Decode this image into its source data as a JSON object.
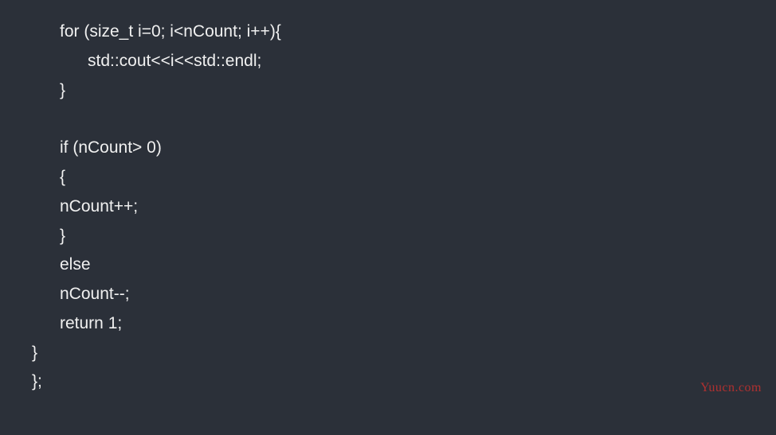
{
  "code": {
    "lines": [
      {
        "indent": 1,
        "text": "for (size_t i=0; i<nCount; i++){"
      },
      {
        "indent": 2,
        "text": "std::cout<<i<<std::endl;"
      },
      {
        "indent": 1,
        "text": "}"
      },
      {
        "indent": 1,
        "text": ""
      },
      {
        "indent": 1,
        "text": "if (nCount> 0)"
      },
      {
        "indent": 1,
        "text": "{"
      },
      {
        "indent": 1,
        "text": "nCount++;"
      },
      {
        "indent": 1,
        "text": "}"
      },
      {
        "indent": 1,
        "text": "else"
      },
      {
        "indent": 1,
        "text": "nCount--;"
      },
      {
        "indent": 1,
        "text": "return 1;"
      },
      {
        "indent": 0,
        "text": "}"
      },
      {
        "indent": 0,
        "text": "};"
      }
    ]
  },
  "watermark": "Yuucn.com"
}
